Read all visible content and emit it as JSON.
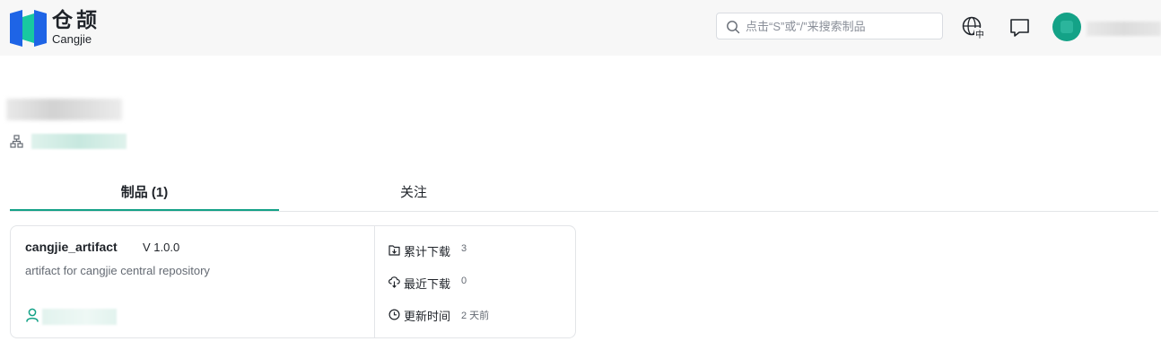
{
  "header": {
    "logo_text_cn": "仓颉",
    "logo_text_en": "Cangjie",
    "search": {
      "placeholder": "点击“S”或“/”来搜索制品"
    },
    "language_badge": "中",
    "brand_color": "#14a287",
    "logo_colors": [
      "#1e64e6",
      "#18c8a0"
    ]
  },
  "tabs": [
    {
      "label": "制品 (1)",
      "active": true
    },
    {
      "label": "关注",
      "active": false
    }
  ],
  "artifacts": [
    {
      "name": "cangjie_artifact",
      "version": "V 1.0.0",
      "description": "artifact for cangjie central repository",
      "stats": {
        "total_downloads_label": "累计下载",
        "total_downloads_value": "3",
        "recent_downloads_label": "最近下载",
        "recent_downloads_value": "0",
        "updated_label": "更新时间",
        "updated_value": "2 天前"
      }
    }
  ]
}
